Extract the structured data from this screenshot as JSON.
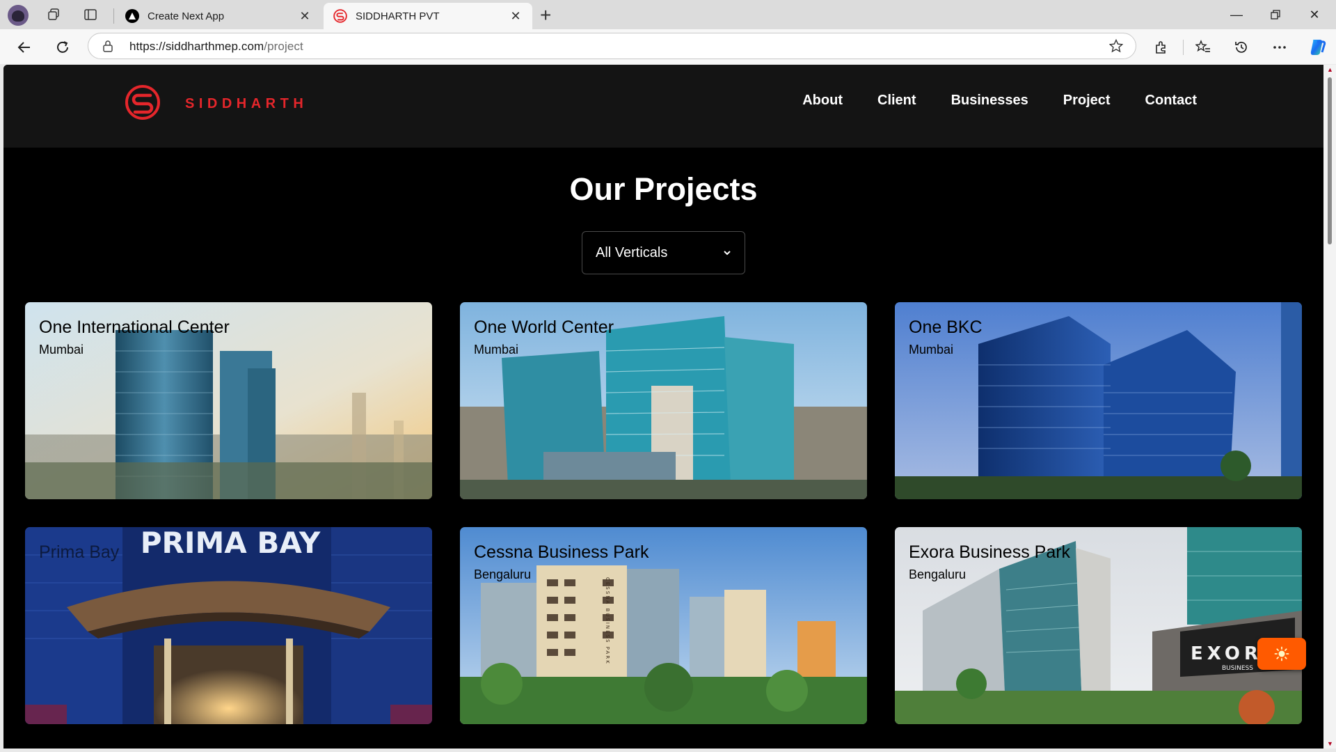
{
  "browser": {
    "tabs": [
      {
        "title": "Create Next App",
        "favicon": "triangle-icon"
      },
      {
        "title": "SIDDHARTH PVT",
        "favicon": "siddharth-logo-icon"
      }
    ],
    "url_host": "https://siddharthmep.com",
    "url_path": "/project"
  },
  "site": {
    "brand": "SIDDHARTH",
    "brand_color": "#e5262b",
    "nav": [
      "About",
      "Client",
      "Businesses",
      "Project",
      "Contact"
    ]
  },
  "main": {
    "title": "Our Projects",
    "filter": {
      "selected": "All Verticals"
    },
    "projects": [
      {
        "name": "One International Center",
        "city": "Mumbai"
      },
      {
        "name": "One World Center",
        "city": "Mumbai"
      },
      {
        "name": "One BKC",
        "city": "Mumbai"
      },
      {
        "name": "Prima Bay",
        "city": ""
      },
      {
        "name": "Cessna Business Park",
        "city": "Bengaluru"
      },
      {
        "name": "Exora Business Park",
        "city": "Bengaluru"
      }
    ]
  },
  "image_text": {
    "prima_bay_sign": "PRIMA BAY",
    "exora_sign": "EXORA",
    "exora_sub": "BUSINESS",
    "cessna_vertical": "CESSNA BUSINESS PARK"
  },
  "fab": {
    "icon": "sun-icon",
    "color": "#ff5a00"
  }
}
